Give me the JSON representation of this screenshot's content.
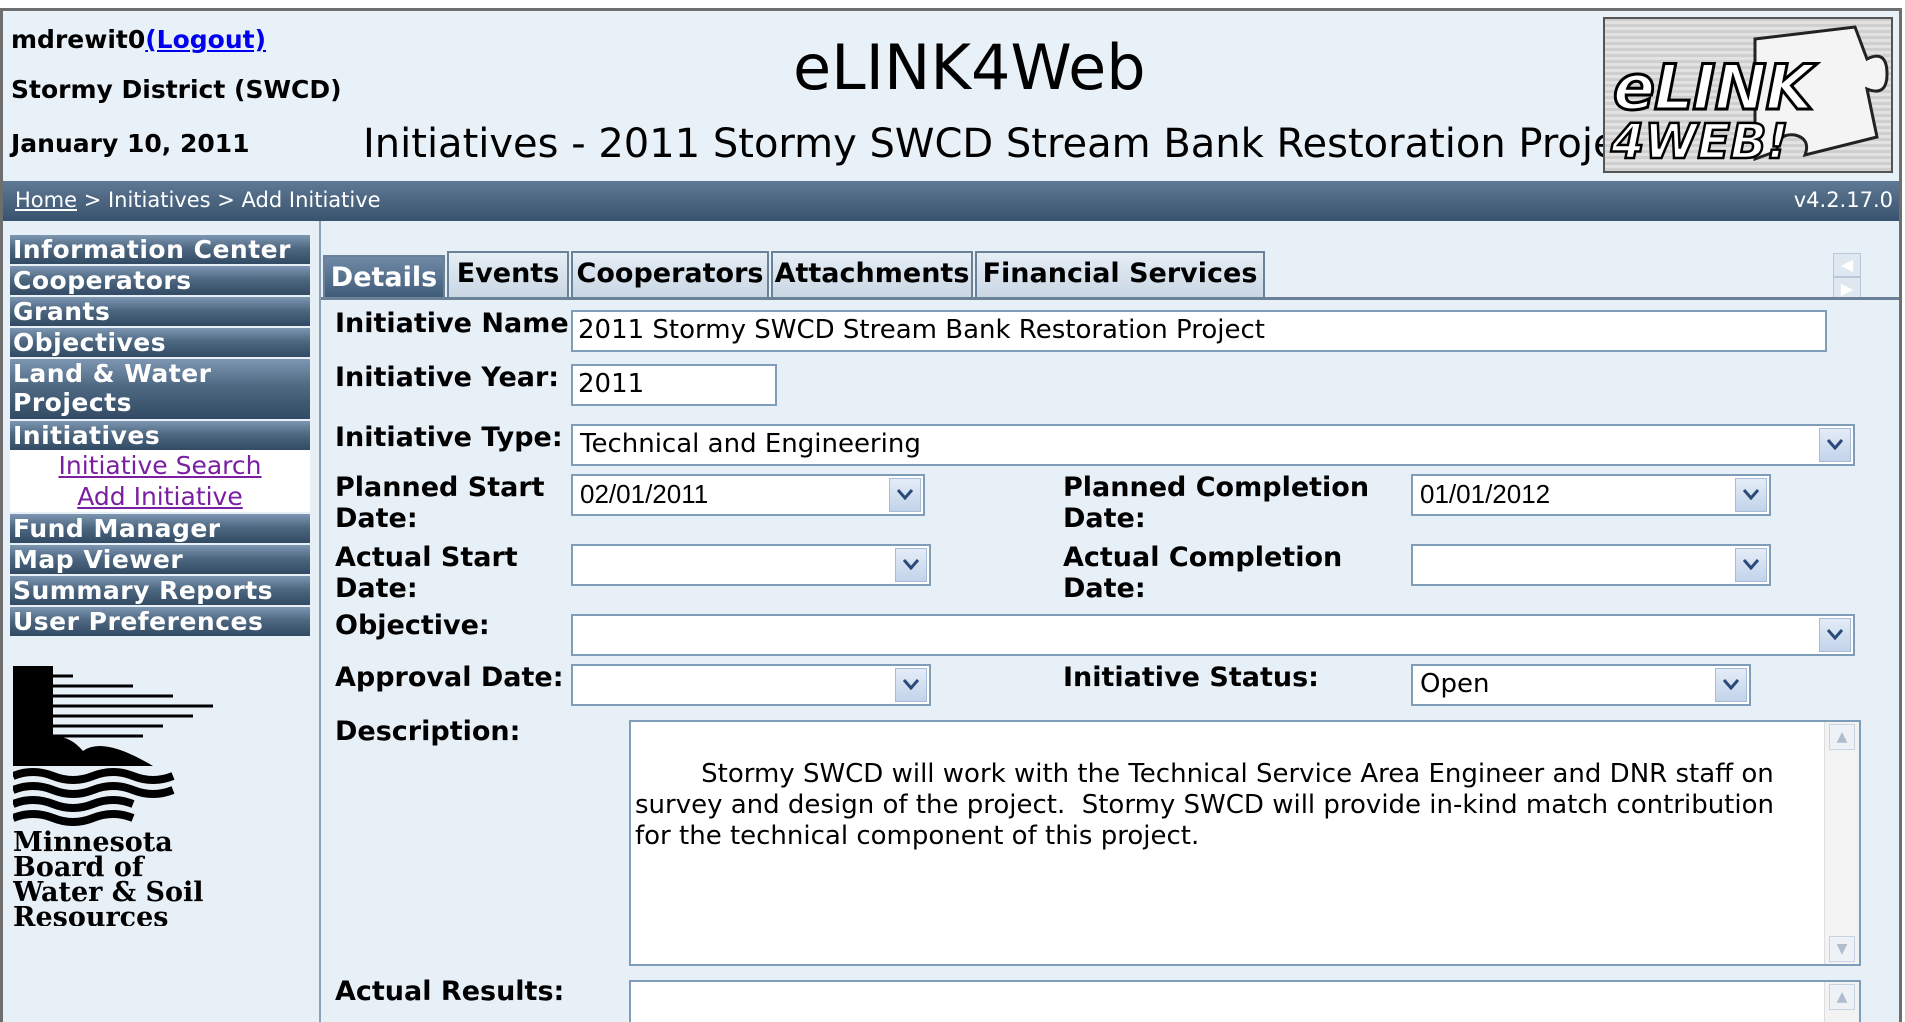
{
  "header": {
    "username": "mdrewit0",
    "logout_label": "(Logout)",
    "district": "Stormy District (SWCD)",
    "date": "January 10, 2011",
    "app_title": "eLINK4Web",
    "page_title": "Initiatives - 2011 Stormy SWCD Stream Bank Restoration Project",
    "logo_line1": "eLINK",
    "logo_line2": "4WEB!"
  },
  "breadcrumb": {
    "home": "Home",
    "rest": " > Initiatives > Add Initiative",
    "version": "v4.2.17.0"
  },
  "nav": {
    "items": [
      "Information Center",
      "Cooperators",
      "Grants",
      "Objectives",
      "Land & Water Projects",
      "Initiatives",
      "Fund Manager",
      "Map Viewer",
      "Summary Reports",
      "User Preferences"
    ],
    "land_water_line1": "Land & Water",
    "land_water_line2": "Projects",
    "subitems": [
      "Initiative Search",
      "Add Initiative"
    ],
    "bwsr_logo_lines": [
      "Minnesota",
      "Board of",
      "Water & Soil",
      "Resources"
    ]
  },
  "tabs": [
    "Details",
    "Events",
    "Cooperators",
    "Attachments",
    "Financial Services"
  ],
  "form": {
    "initiative_name_label": "Initiative Name:",
    "initiative_name_value": "2011 Stormy SWCD Stream Bank Restoration Project",
    "initiative_year_label": "Initiative Year:",
    "initiative_year_value": "2011",
    "initiative_type_label": "Initiative Type:",
    "initiative_type_value": "Technical and Engineering",
    "planned_start_label_1": "Planned Start",
    "planned_start_label_2": "Date:",
    "planned_start_value": "02/01/2011",
    "planned_completion_label_1": "Planned Completion",
    "planned_completion_label_2": "Date:",
    "planned_completion_value": "01/01/2012",
    "actual_start_label_1": "Actual Start",
    "actual_start_label_2": "Date:",
    "actual_start_value": "",
    "actual_completion_label_1": "Actual Completion",
    "actual_completion_label_2": "Date:",
    "actual_completion_value": "",
    "objective_label": "Objective:",
    "objective_value": "",
    "approval_date_label": "Approval Date:",
    "approval_date_value": "",
    "initiative_status_label": "Initiative Status:",
    "initiative_status_value": "Open",
    "description_label": "Description:",
    "description_value": "Stormy SWCD will work with the Technical Service Area Engineer and DNR staff on survey and design of the project.  Stormy SWCD will provide in-kind match contribution for the technical component of this project.",
    "actual_results_label": "Actual Results:",
    "actual_results_value": ""
  }
}
